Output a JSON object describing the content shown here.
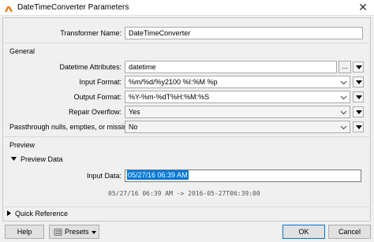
{
  "window": {
    "title": "DateTimeConverter Parameters",
    "close_glyph": "✕"
  },
  "transformer": {
    "name_label": "Transformer Name:",
    "name_value": "DateTimeConverter"
  },
  "general": {
    "section_label": "General",
    "datetime_attributes_label": "Datetime Attributes:",
    "datetime_attributes_value": "datetime",
    "ellipsis_button": "...",
    "input_format_label": "Input Format:",
    "input_format_value": "%m/%d/%y2100 %I:%M %p",
    "output_format_label": "Output Format:",
    "output_format_value": "%Y-%m-%dT%H:%M:%S",
    "repair_overflow_label": "Repair Overflow:",
    "repair_overflow_value": "Yes",
    "passthrough_label": "Passthrough nulls, empties, or missing:",
    "passthrough_value": "No"
  },
  "preview": {
    "section_label": "Preview",
    "preview_data_label": "Preview Data",
    "input_data_label": "Input Data:",
    "input_data_value": "05/27/16 06:39 AM",
    "result_text": "05/27/16 06:39 AM -> 2016-05-27T06:39:00"
  },
  "quick_reference": {
    "label": "Quick Reference"
  },
  "footer": {
    "help_label": "Help",
    "presets_label": "Presets",
    "ok_label": "OK",
    "cancel_label": "Cancel"
  },
  "colors": {
    "selection": "#0078d7",
    "app_icon": "#e8740c"
  },
  "icons": {
    "app": "fme-workbench-icon",
    "close": "close-icon",
    "dropdown": "chevron-down-icon",
    "menu_arrow": "triangle-down-icon",
    "expand": "triangle-right-icon",
    "collapse": "triangle-down-icon",
    "presets": "presets-icon"
  }
}
